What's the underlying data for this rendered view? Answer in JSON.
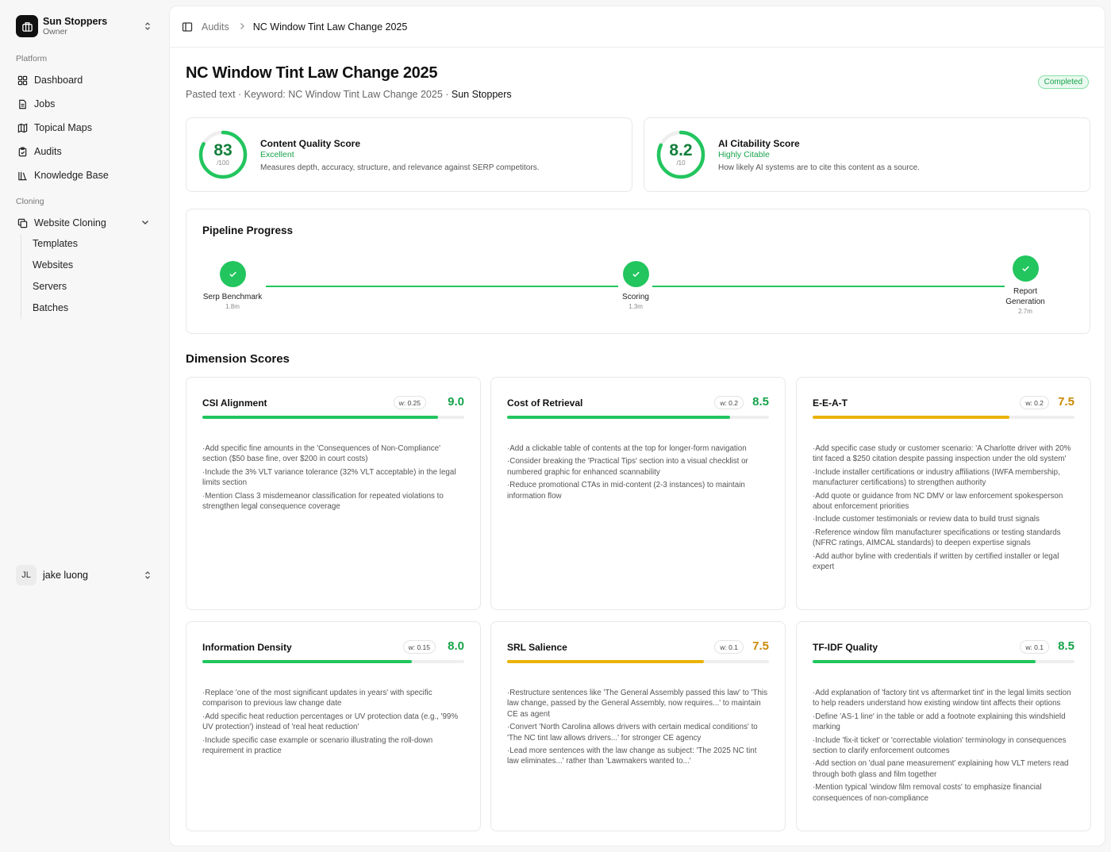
{
  "org": {
    "name": "Sun Stoppers",
    "role": "Owner"
  },
  "sidebar": {
    "platform_label": "Platform",
    "items": [
      {
        "label": "Dashboard",
        "icon": "dashboard-grid-icon"
      },
      {
        "label": "Jobs",
        "icon": "file-icon"
      },
      {
        "label": "Topical Maps",
        "icon": "map-icon"
      },
      {
        "label": "Audits",
        "icon": "clipboard-icon"
      },
      {
        "label": "Knowledge Base",
        "icon": "library-icon"
      }
    ],
    "cloning_label": "Cloning",
    "cloning": {
      "label": "Website Cloning",
      "icon": "copy-icon",
      "children": [
        "Templates",
        "Websites",
        "Servers",
        "Batches"
      ]
    }
  },
  "user": {
    "initials": "JL",
    "name": "jake luong"
  },
  "breadcrumb": {
    "parent": "Audits",
    "current": "NC Window Tint Law Change 2025"
  },
  "page": {
    "title": "NC Window Tint Law Change 2025",
    "meta_prefix": "Pasted text · Keyword: NC Window Tint Law Change 2025 · ",
    "meta_org": "Sun Stoppers",
    "status": "Completed"
  },
  "scores": {
    "content_quality": {
      "value": "83",
      "max": "/100",
      "fraction": 0.83,
      "title": "Content Quality Score",
      "grade": "Excellent",
      "description": "Measures depth, accuracy, structure, and relevance against SERP competitors."
    },
    "ai_citability": {
      "value": "8.2",
      "max": "/10",
      "fraction": 0.82,
      "title": "AI Citability Score",
      "grade": "Highly Citable",
      "description": "How likely AI systems are to cite this content as a source."
    }
  },
  "pipeline": {
    "title": "Pipeline Progress",
    "steps": [
      {
        "label": "Serp Benchmark",
        "time": "1.8m"
      },
      {
        "label": "Scoring",
        "time": "1.3m"
      },
      {
        "label": "Report Generation",
        "time": "2.7m"
      }
    ]
  },
  "dimensions": {
    "title": "Dimension Scores",
    "cards": [
      {
        "title": "CSI Alignment",
        "weight": "w: 0.25",
        "score": "9.0",
        "fraction": 0.9,
        "color": "#22c55e",
        "score_color": "#16a34a",
        "notes": [
          "Add specific fine amounts in the 'Consequences of Non-Compliance' section ($50 base fine, over $200 in court costs)",
          "Include the 3% VLT variance tolerance (32% VLT acceptable) in the legal limits section",
          "Mention Class 3 misdemeanor classification for repeated violations to strengthen legal consequence coverage"
        ]
      },
      {
        "title": "Cost of Retrieval",
        "weight": "w: 0.2",
        "score": "8.5",
        "fraction": 0.85,
        "color": "#22c55e",
        "score_color": "#16a34a",
        "notes": [
          "Add a clickable table of contents at the top for longer-form navigation",
          "Consider breaking the 'Practical Tips' section into a visual checklist or numbered graphic for enhanced scannability",
          "Reduce promotional CTAs in mid-content (2-3 instances) to maintain information flow"
        ]
      },
      {
        "title": "E-E-A-T",
        "weight": "w: 0.2",
        "score": "7.5",
        "fraction": 0.75,
        "color": "#eab308",
        "score_color": "#ca8a04",
        "notes": [
          "Add specific case study or customer scenario: 'A Charlotte driver with 20% tint faced a $250 citation despite passing inspection under the old system'",
          "Include installer certifications or industry affiliations (IWFA membership, manufacturer certifications) to strengthen authority",
          "Add quote or guidance from NC DMV or law enforcement spokesperson about enforcement priorities",
          "Include customer testimonials or review data to build trust signals",
          "Reference window film manufacturer specifications or testing standards (NFRC ratings, AIMCAL standards) to deepen expertise signals",
          "Add author byline with credentials if written by certified installer or legal expert"
        ]
      },
      {
        "title": "Information Density",
        "weight": "w: 0.15",
        "score": "8.0",
        "fraction": 0.8,
        "color": "#22c55e",
        "score_color": "#16a34a",
        "notes": [
          "Replace 'one of the most significant updates in years' with specific comparison to previous law change date",
          "Add specific heat reduction percentages or UV protection data (e.g., '99% UV protection') instead of 'real heat reduction'",
          "Include specific case example or scenario illustrating the roll-down requirement in practice"
        ]
      },
      {
        "title": "SRL Salience",
        "weight": "w: 0.1",
        "score": "7.5",
        "fraction": 0.75,
        "color": "#eab308",
        "score_color": "#ca8a04",
        "notes": [
          "Restructure sentences like 'The General Assembly passed this law' to 'This law change, passed by the General Assembly, now requires...' to maintain CE as agent",
          "Convert 'North Carolina allows drivers with certain medical conditions' to 'The NC tint law allows drivers...' for stronger CE agency",
          "Lead more sentences with the law change as subject: 'The 2025 NC tint law eliminates...' rather than 'Lawmakers wanted to...'"
        ]
      },
      {
        "title": "TF-IDF Quality",
        "weight": "w: 0.1",
        "score": "8.5",
        "fraction": 0.85,
        "color": "#22c55e",
        "score_color": "#16a34a",
        "notes": [
          "Add explanation of 'factory tint vs aftermarket tint' in the legal limits section to help readers understand how existing window tint affects their options",
          "Define 'AS-1 line' in the table or add a footnote explaining this windshield marking",
          "Include 'fix-it ticket' or 'correctable violation' terminology in consequences section to clarify enforcement outcomes",
          "Add section on 'dual pane measurement' explaining how VLT meters read through both glass and film together",
          "Mention typical 'window film removal costs' to emphasize financial consequences of non-compliance"
        ]
      }
    ]
  }
}
